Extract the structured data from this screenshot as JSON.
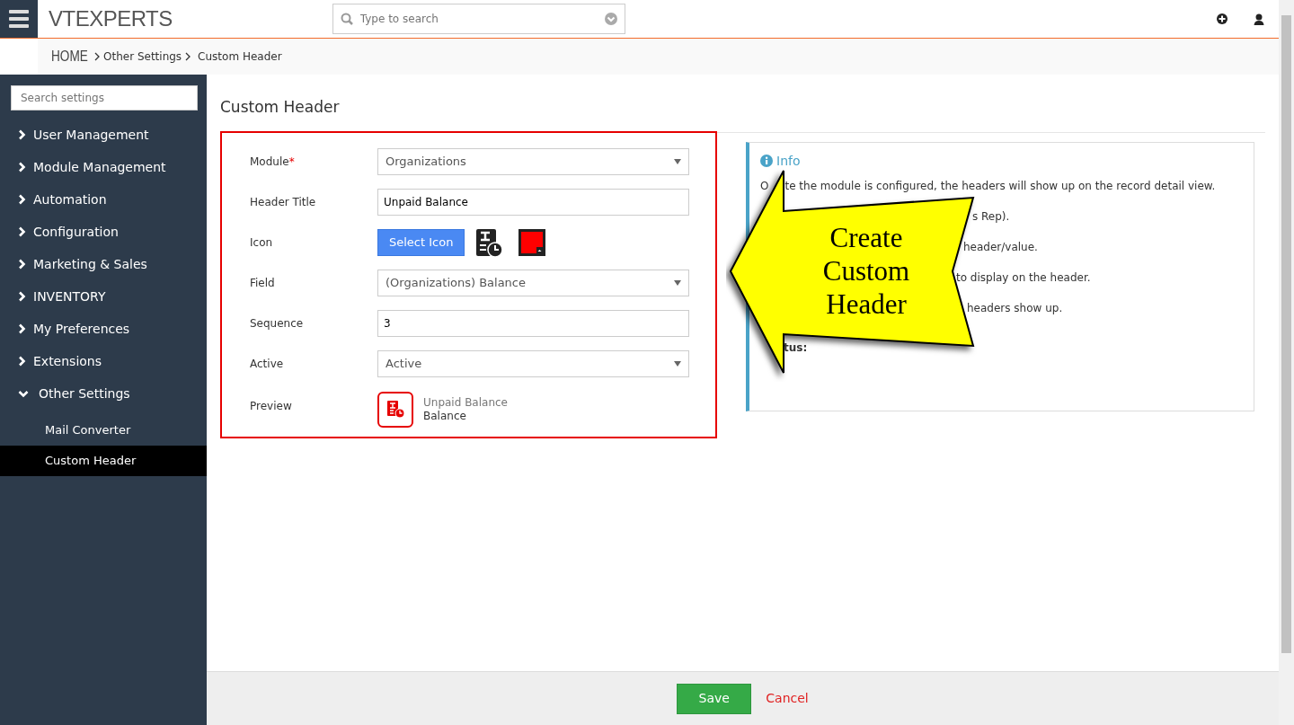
{
  "topbar": {
    "logo": "VTEXPERTS",
    "search": {
      "placeholder": "Type to search"
    }
  },
  "breadcrumb": [
    {
      "label": "HOME",
      "kind": "home"
    },
    {
      "label": "Other Settings",
      "kind": "link"
    },
    {
      "label": "Custom Header",
      "kind": "current"
    }
  ],
  "sidebar": {
    "search": {
      "placeholder": "Search settings"
    },
    "items": [
      {
        "label": "User Management",
        "expanded": false
      },
      {
        "label": "Module Management",
        "expanded": false
      },
      {
        "label": "Automation",
        "expanded": false
      },
      {
        "label": "Configuration",
        "expanded": false
      },
      {
        "label": "Marketing & Sales",
        "expanded": false
      },
      {
        "label": "INVENTORY",
        "expanded": false
      },
      {
        "label": "My Preferences",
        "expanded": false
      },
      {
        "label": "Extensions",
        "expanded": false
      },
      {
        "label": "Other Settings",
        "expanded": true,
        "children": [
          {
            "label": "Mail Converter",
            "selected": false
          },
          {
            "label": "Custom Header",
            "selected": true
          }
        ]
      }
    ]
  },
  "page_title": "Custom Header",
  "form": {
    "fields": [
      {
        "label": "Module",
        "required_mark": "*",
        "kind": "select",
        "value": "Organizations"
      },
      {
        "label": "Header Title",
        "kind": "text",
        "value": "Unpaid Balance"
      },
      {
        "label": "Icon",
        "kind": "icon",
        "button": "Select Icon",
        "color": "#ff0000"
      },
      {
        "label": "Field",
        "kind": "select",
        "value": "(Organizations) Balance"
      },
      {
        "label": "Sequence",
        "kind": "text",
        "value": "3"
      },
      {
        "label": "Active",
        "kind": "select",
        "value": "Active"
      },
      {
        "label": "Preview",
        "kind": "preview",
        "title": "Unpaid Balance",
        "value": "Balance"
      }
    ]
  },
  "info": {
    "title": "Info",
    "lines": [
      {
        "text": "O",
        "kind": "full"
      },
      {
        "text": "te the module is configured, the headers will show up on the record detail view.",
        "kind": "tail"
      },
      {
        "text": "s Rep).",
        "kind": "partial"
      },
      {
        "text": "header/value.",
        "kind": "partial"
      },
      {
        "text": "to display on the header.",
        "kind": "partial"
      },
      {
        "text": "headers show up.",
        "kind": "partial"
      },
      {
        "text": "tus:",
        "kind": "bold"
      }
    ]
  },
  "callout": {
    "lines": [
      "Create",
      "Custom",
      "Header"
    ]
  },
  "footer": {
    "save": "Save",
    "cancel": "Cancel"
  }
}
